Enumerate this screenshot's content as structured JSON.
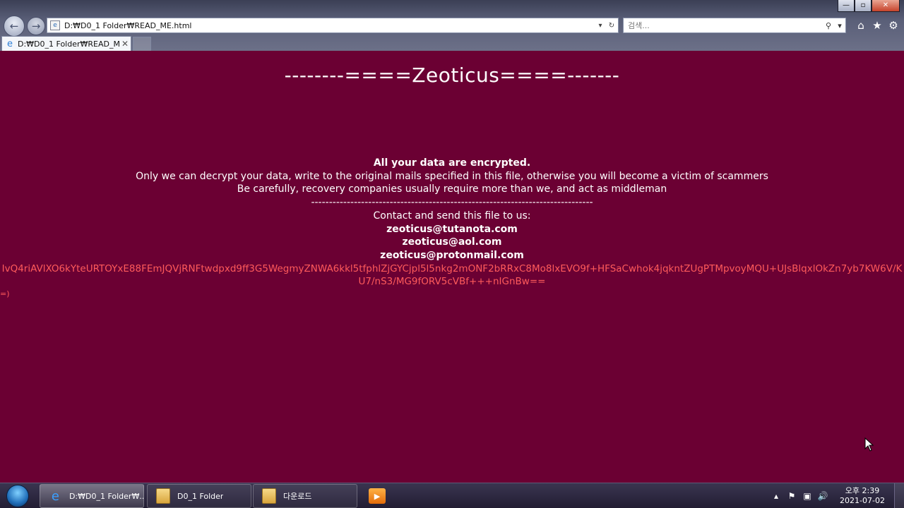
{
  "browser": {
    "address": "D:₩D0_1 Folder₩READ_ME.html",
    "search_placeholder": "검색...",
    "tab_label": "D:₩D0_1 Folder₩READ_M...",
    "window_controls": {
      "minimize": "—",
      "maximize": "▫",
      "close": "✕"
    }
  },
  "page": {
    "title": "--------====Zeoticus====-------",
    "headline": "All your data are encrypted.",
    "line1": "Only we can decrypt your data, write to the original mails specified in this file, otherwise you will become a victim of scammers",
    "line2": "Be carefully, recovery companies usually require more than we, and act as middleman",
    "separator": "-------------------------------------------------------------------------------",
    "contact_label": "Contact and send this file to us:",
    "emails": [
      "zeoticus@tutanota.com",
      "zeoticus@aol.com",
      "zeoticus@protonmail.com"
    ],
    "key": "IvQ4riAVlXO6kYteURTOYxE88FEmJQVjRNFtwdpxd9ff3G5WegmyZNWA6kkl5tfphlZjGYCjpl5l5nkg2mONF2bRRxC8Mo8lxEVO9f+HFSaCwhok4jqkntZUgPTMpvoyMQU+UJsBlqxlOkZn7yb7KW6V/KU7/nS3/MG9fORV5cVBf+++nIGnBw==",
    "smiley": "=)"
  },
  "taskbar": {
    "tasks": [
      {
        "label": "D:₩D0_1 Folder₩...",
        "icon": "ie-icon"
      },
      {
        "label": "D0_1 Folder",
        "icon": "folder-icon"
      },
      {
        "label": "다운로드",
        "icon": "download-folder-icon"
      }
    ],
    "clock_ampm_time": "오후 2:39",
    "clock_date": "2021-07-02"
  },
  "colors": {
    "page_background": "#6b0033",
    "key_text": "#ff5b5b",
    "text": "#ffffff"
  }
}
